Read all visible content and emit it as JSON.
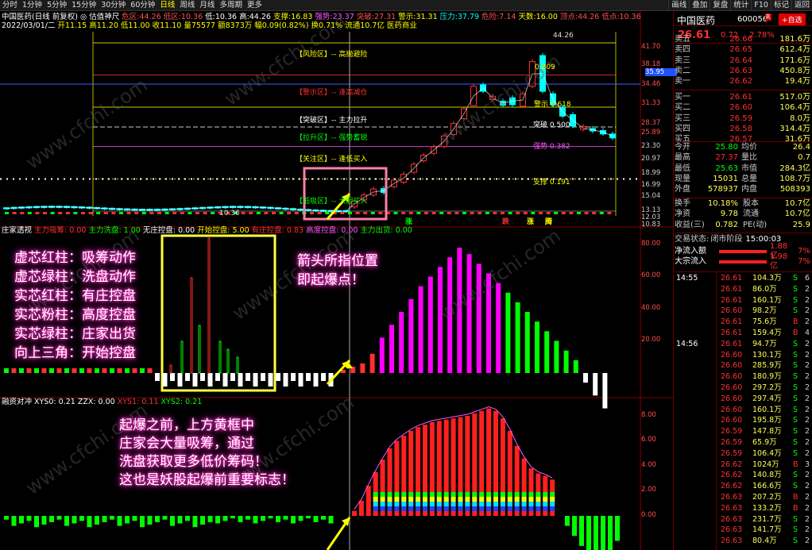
{
  "toolbar": {
    "items": [
      "分时",
      "1分钟",
      "5分钟",
      "15分钟",
      "30分钟",
      "60分钟",
      "日线",
      "周线",
      "月线",
      "多周期",
      "更多"
    ],
    "active": "日线",
    "right_items": [
      "画线",
      "叠加",
      "复盘",
      "统计",
      "F10",
      "标记",
      "返回"
    ]
  },
  "chart_header": {
    "line1": {
      "name": "中国医药(日线 前复权)",
      "indicator": "◎ 估值神尺",
      "items": [
        [
          "危区:",
          "44.26"
        ],
        [
          "低区:",
          "10.36"
        ],
        [
          "低:",
          "10.36"
        ],
        [
          "高:",
          "44.26"
        ],
        [
          "支撑:",
          "16.83"
        ],
        [
          "强势:",
          "23.37"
        ],
        [
          "突破:",
          "27.31"
        ],
        [
          "警示:",
          "31.31"
        ],
        [
          "压力:",
          "37.79"
        ],
        [
          "危险:",
          "7.14"
        ],
        [
          "天数:",
          "16.00"
        ],
        [
          "顶点:",
          "44.26"
        ],
        [
          "低点:",
          "10.36"
        ]
      ]
    },
    "line2": {
      "date": "2022/03/01/二",
      "values": "开11.15 高11.20 低11.00 收11.10 量75577 额8373万 幅0.09(0.82%) 换0.71% 流通10.7亿 医药商业"
    }
  },
  "zones": [
    {
      "label": "【风险区】-- 高抛避险",
      "color": "#ffff00"
    },
    {
      "label": "【警示区】-- 逢高减仓",
      "color": "#ff3030"
    },
    {
      "label": "【突破区】-- 主力拉升",
      "color": "#ffffff"
    },
    {
      "label": "【拉升区】-- 强势蓄锐",
      "color": "#00ff00"
    },
    {
      "label": "【关注区】-- 逢低买入",
      "color": "#ffff00"
    },
    {
      "label": "【低吸区】-- 大胆买入",
      "color": "#00ff00"
    }
  ],
  "levels": [
    {
      "label": "44.26",
      "color": "#dddddd"
    },
    {
      "label": "0.809",
      "color": "#ffff00"
    },
    {
      "label": "警示 0.618",
      "color": "#ffff00"
    },
    {
      "label": "突破 0.500",
      "color": "#ffffff"
    },
    {
      "label": "强势 0.382",
      "color": "#ff55ff"
    },
    {
      "label": "支撑 0.191",
      "color": "#ffff00"
    },
    {
      "label": "10.36",
      "color": "#dddddd"
    }
  ],
  "price_axis": [
    "41.70",
    "38.18",
    "34.46",
    "31.33",
    "28.37",
    "25.89",
    "23.30",
    "20.97",
    "18.99",
    "16.99",
    "15.04",
    "13.13",
    "12.03",
    "10.83"
  ],
  "price_axis_marker": "35.95",
  "price_markers": [
    {
      "label": "涨",
      "color": "#00ff00"
    },
    {
      "label": "跌",
      "color": "#ff3030"
    },
    {
      "label": "涨",
      "color": "#ffff00"
    },
    {
      "label": "腾",
      "color": "#ffff00"
    }
  ],
  "panel2": {
    "title": "庄家透视",
    "items": [
      [
        "主力吸筹: 0.00",
        "#ff3030"
      ],
      [
        "主力洗盘: 1.00",
        "#00ff00"
      ],
      [
        "无庄控盘: 0.00",
        "#ffffff"
      ],
      [
        "开始控盘: 5.00",
        "#ffff00"
      ],
      [
        "有庄控盘: 0.83",
        "#ff3030"
      ],
      [
        "高度控盘: 0.00",
        "#ff55ff"
      ],
      [
        "主力出货: 0.00",
        "#00ff00"
      ]
    ],
    "axis": [
      "80.00",
      "60.00",
      "40.00",
      "20.00"
    ]
  },
  "panel3": {
    "title": "融资对冲",
    "items": [
      [
        "XYS0: 0.21",
        "#ffffff"
      ],
      [
        "ZZX: 0.00",
        "#ffffff"
      ],
      [
        "XYS1: 0.11",
        "#ff3030"
      ],
      [
        "XYS2: 0.21",
        "#00ff00"
      ]
    ],
    "axis": [
      "8.00",
      "6.00",
      "4.00",
      "2.00",
      "0.00"
    ]
  },
  "annotations": {
    "legend_lines": [
      "虚芯红柱：吸筹动作",
      "虚芯绿柱：洗盘动作",
      "实芯红柱：有庄控盘",
      "实芯粉柱：高度控盘",
      "实芯绿柱：庄家出货",
      "向上三角：开始控盘"
    ],
    "arrow_note": [
      "箭头所指位置",
      "即起爆点！"
    ],
    "box_note": [
      "起爆之前，上方黄框中",
      "庄家会大量吸筹，通过",
      "洗盘获取更多低价筹码！",
      "这也是妖股起爆前重要标志！"
    ]
  },
  "watermark": "www.cfchi.com",
  "quote": {
    "name": "中国医药",
    "code": "600056",
    "badge": "R",
    "button": "+自选",
    "price": "26.61",
    "change": "0.72",
    "pct": "2.78%",
    "asks": [
      [
        "卖五",
        "26.66",
        "181.6万"
      ],
      [
        "卖四",
        "26.65",
        "612.4万"
      ],
      [
        "卖三",
        "26.64",
        "171.6万"
      ],
      [
        "卖二",
        "26.63",
        "450.8万"
      ],
      [
        "卖一",
        "26.62",
        "19.4万"
      ]
    ],
    "bids": [
      [
        "买一",
        "26.61",
        "517.0万"
      ],
      [
        "买二",
        "26.60",
        "106.4万"
      ],
      [
        "买三",
        "26.59",
        "8.0万"
      ],
      [
        "买四",
        "26.58",
        "314.4万"
      ],
      [
        "买五",
        "26.57",
        "31.6万"
      ]
    ],
    "stats": [
      [
        "今开",
        "25.80",
        "均价",
        "26.4"
      ],
      [
        "最高",
        "27.37",
        "量比",
        "0.7"
      ],
      [
        "最低",
        "25.63",
        "市值",
        "284.3亿"
      ],
      [
        "现量",
        "15031",
        "总量",
        "108.7万"
      ],
      [
        "外盘",
        "578937",
        "内盘",
        "508393"
      ]
    ],
    "stats2": [
      [
        "换手",
        "10.18%",
        "股本",
        "10.7亿"
      ],
      [
        "净资",
        "9.78",
        "流通",
        "10.7亿"
      ],
      [
        "收益(三)",
        "0.782",
        "PE(动)",
        "25.9"
      ]
    ],
    "status_label": "交易状态:",
    "status": "闭市阶段",
    "status_time": "15:00:03",
    "flows": [
      [
        "净流入额",
        "1.88亿",
        "7%"
      ],
      [
        "大宗流入",
        "1.98亿",
        "7%"
      ]
    ],
    "ticks": [
      [
        "14:55",
        "26.61",
        "104.3万",
        "S",
        "6"
      ],
      [
        "",
        "26.61",
        "86.0万",
        "S",
        "2"
      ],
      [
        "",
        "26.61",
        "160.1万",
        "S",
        "2"
      ],
      [
        "",
        "26.60",
        "98.2万",
        "S",
        "2"
      ],
      [
        "",
        "26.61",
        "75.6万",
        "B",
        "2"
      ],
      [
        "",
        "26.61",
        "159.4万",
        "B",
        "4"
      ],
      [
        "14:56",
        "26.61",
        "94.7万",
        "S",
        "2"
      ],
      [
        "",
        "26.60",
        "130.1万",
        "S",
        "2"
      ],
      [
        "",
        "26.60",
        "285.9万",
        "S",
        "2"
      ],
      [
        "",
        "26.60",
        "180.9万",
        "S",
        "2"
      ],
      [
        "",
        "26.60",
        "297.2万",
        "S",
        "2"
      ],
      [
        "",
        "26.60",
        "297.4万",
        "S",
        "2"
      ],
      [
        "",
        "26.60",
        "160.1万",
        "S",
        "2"
      ],
      [
        "",
        "26.60",
        "195.8万",
        "S",
        "2"
      ],
      [
        "",
        "26.59",
        "147.8万",
        "S",
        "2"
      ],
      [
        "",
        "26.59",
        "65.9万",
        "S",
        "2"
      ],
      [
        "",
        "26.59",
        "106.4万",
        "S",
        "2"
      ],
      [
        "",
        "26.62",
        "1024万",
        "B",
        "3"
      ],
      [
        "",
        "26.62",
        "140.8万",
        "S",
        "2"
      ],
      [
        "",
        "26.62",
        "166.6万",
        "S",
        "2"
      ],
      [
        "",
        "26.63",
        "207.2万",
        "B",
        "2"
      ],
      [
        "",
        "26.63",
        "133.2万",
        "B",
        "2"
      ],
      [
        "",
        "26.63",
        "231.7万",
        "S",
        "2"
      ],
      [
        "",
        "26.63",
        "141.7万",
        "S",
        "2"
      ],
      [
        "",
        "26.63",
        "80.4万",
        "S",
        "2"
      ]
    ]
  },
  "colors": {
    "up": "#ff3030",
    "down": "#00ff00",
    "yellow": "#ffff00",
    "magenta": "#ff00ff",
    "cyan": "#00ffff"
  }
}
